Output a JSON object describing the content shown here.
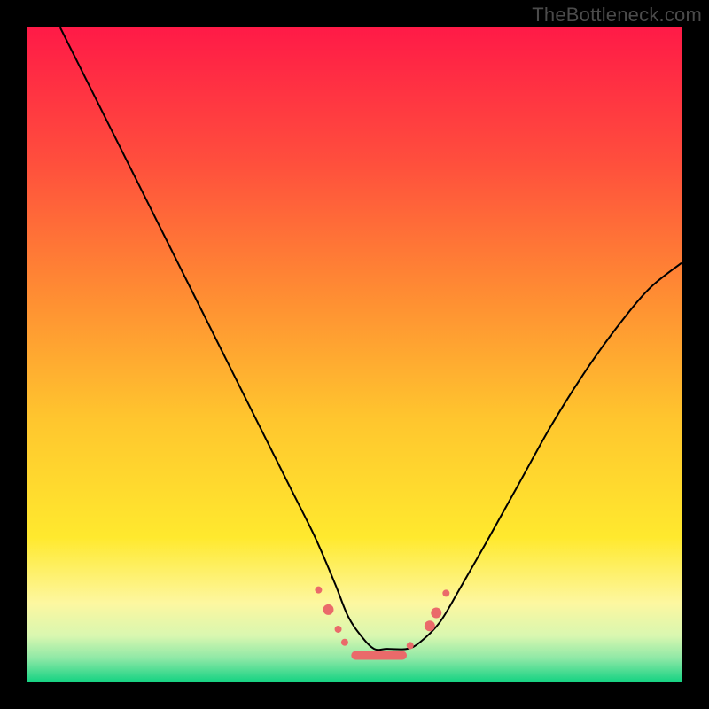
{
  "watermark": "TheBottleneck.com",
  "chart_data": {
    "type": "line",
    "title": "",
    "xlabel": "",
    "ylabel": "",
    "xlim": [
      0,
      100
    ],
    "ylim": [
      0,
      100
    ],
    "grid": false,
    "legend": false,
    "background_gradient": {
      "orientation": "vertical",
      "stops": [
        {
          "pos": 0.0,
          "color": "#ff1a47"
        },
        {
          "pos": 0.2,
          "color": "#ff4d3d"
        },
        {
          "pos": 0.4,
          "color": "#ff8a33"
        },
        {
          "pos": 0.6,
          "color": "#ffc62e"
        },
        {
          "pos": 0.78,
          "color": "#ffe92e"
        },
        {
          "pos": 0.88,
          "color": "#fdf7a0"
        },
        {
          "pos": 0.93,
          "color": "#d9f7b0"
        },
        {
          "pos": 0.965,
          "color": "#8de8a6"
        },
        {
          "pos": 1.0,
          "color": "#17d383"
        }
      ]
    },
    "series": [
      {
        "name": "bottleneck-curve",
        "stroke": "#000000",
        "stroke_width": 2,
        "x": [
          5,
          8,
          12,
          16,
          20,
          24,
          28,
          32,
          36,
          40,
          44,
          47,
          49,
          51,
          53,
          55,
          58,
          60,
          63,
          66,
          70,
          75,
          80,
          85,
          90,
          95,
          100
        ],
        "y": [
          100,
          94,
          86,
          78,
          70,
          62,
          54,
          46,
          38,
          30,
          22,
          15,
          10,
          7,
          5,
          5,
          5,
          6,
          9,
          14,
          21,
          30,
          39,
          47,
          54,
          60,
          64
        ]
      }
    ],
    "markers": {
      "name": "highlight-dots",
      "fill": "#ea6a6a",
      "radius_small": 4,
      "radius_large": 6,
      "points": [
        {
          "x": 44.5,
          "y": 14.0,
          "r": "small"
        },
        {
          "x": 46.0,
          "y": 11.0,
          "r": "large"
        },
        {
          "x": 47.5,
          "y": 8.0,
          "r": "small"
        },
        {
          "x": 48.5,
          "y": 6.0,
          "r": "small"
        },
        {
          "x": 58.5,
          "y": 5.5,
          "r": "small"
        },
        {
          "x": 61.5,
          "y": 8.5,
          "r": "large"
        },
        {
          "x": 62.5,
          "y": 10.5,
          "r": "large"
        },
        {
          "x": 64.0,
          "y": 13.5,
          "r": "small"
        }
      ],
      "bar": {
        "x1": 49.5,
        "x2": 58.0,
        "y": 4.0,
        "thickness": 5
      }
    }
  }
}
